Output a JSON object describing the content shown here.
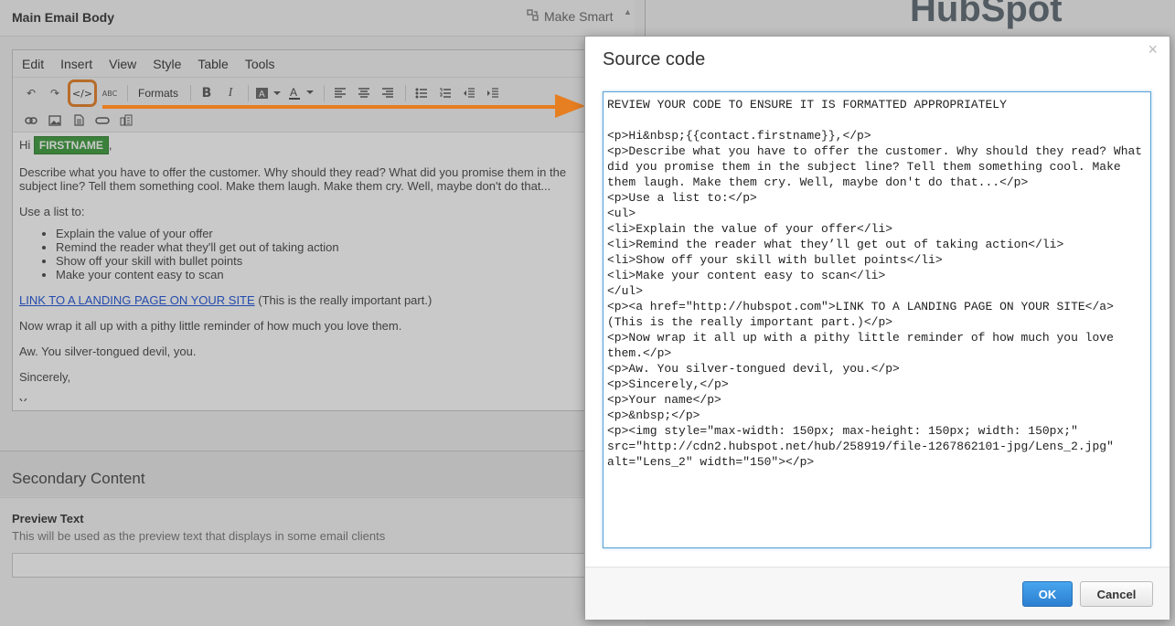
{
  "editor": {
    "section_title": "Main Email Body",
    "make_smart": "Make Smart",
    "menu": [
      "Edit",
      "Insert",
      "View",
      "Style",
      "Table",
      "Tools"
    ],
    "formats_label": "Formats",
    "content": {
      "greeting": "Hi",
      "token": "FIRSTNAME",
      "greeting_end": ",",
      "p1": "Describe what you have to offer the customer. Why should they read? What did you promise them in the subject line? Tell them something cool. Make them laugh. Make them cry. Well, maybe don't do that...",
      "p2": "Use a list to:",
      "list": [
        "Explain the value of your offer",
        "Remind the reader what they'll get out of taking action",
        "Show off your skill with bullet points",
        "Make your content easy to scan"
      ],
      "link": "LINK TO A LANDING PAGE ON YOUR SITE",
      "link_after": " (This is the really important part.)",
      "p3": "Now wrap it all up with a pithy little reminder of how much you love them.",
      "p4": "Aw. You silver-tongued devil, you.",
      "p5": "Sincerely,",
      "p6": "Y"
    }
  },
  "secondary": {
    "title": "Secondary Content",
    "preview_label": "Preview Text",
    "preview_help": "This will be used as the preview text that displays in some email clients",
    "preview_value": ""
  },
  "brand": {
    "logo_text": "HubSpot"
  },
  "modal": {
    "title": "Source code",
    "close": "×",
    "code": "REVIEW YOUR CODE TO ENSURE IT IS FORMATTED APPROPRIATELY\n\n<p>Hi&nbsp;{{contact.firstname}},</p>\n<p>Describe what you have to offer the customer. Why should they read? What did you promise them in the subject line? Tell them something cool. Make them laugh. Make them cry. Well, maybe don't do that...</p>\n<p>Use a list to:</p>\n<ul>\n<li>Explain the value of your offer</li>\n<li>Remind the reader what they’ll get out of taking action</li>\n<li>Show off your skill with bullet points</li>\n<li>Make your content easy to scan</li>\n</ul>\n<p><a href=\"http://hubspot.com\">LINK TO A LANDING PAGE ON YOUR SITE</a> (This is the really important part.)</p>\n<p>Now wrap it all up with a pithy little reminder of how much you love them.</p>\n<p>Aw. You silver-tongued devil, you.</p>\n<p>Sincerely,</p>\n<p>Your name</p>\n<p>&nbsp;</p>\n<p><img style=\"max-width: 150px; max-height: 150px; width: 150px;\" src=\"http://cdn2.hubspot.net/hub/258919/file-1267862101-jpg/Lens_2.jpg\" alt=\"Lens_2\" width=\"150\"></p>",
    "ok_label": "OK",
    "cancel_label": "Cancel"
  },
  "colors": {
    "annotation_orange": "#e67e22",
    "ok_blue": "#2a7fd0",
    "token_green": "#3a9a3a"
  }
}
